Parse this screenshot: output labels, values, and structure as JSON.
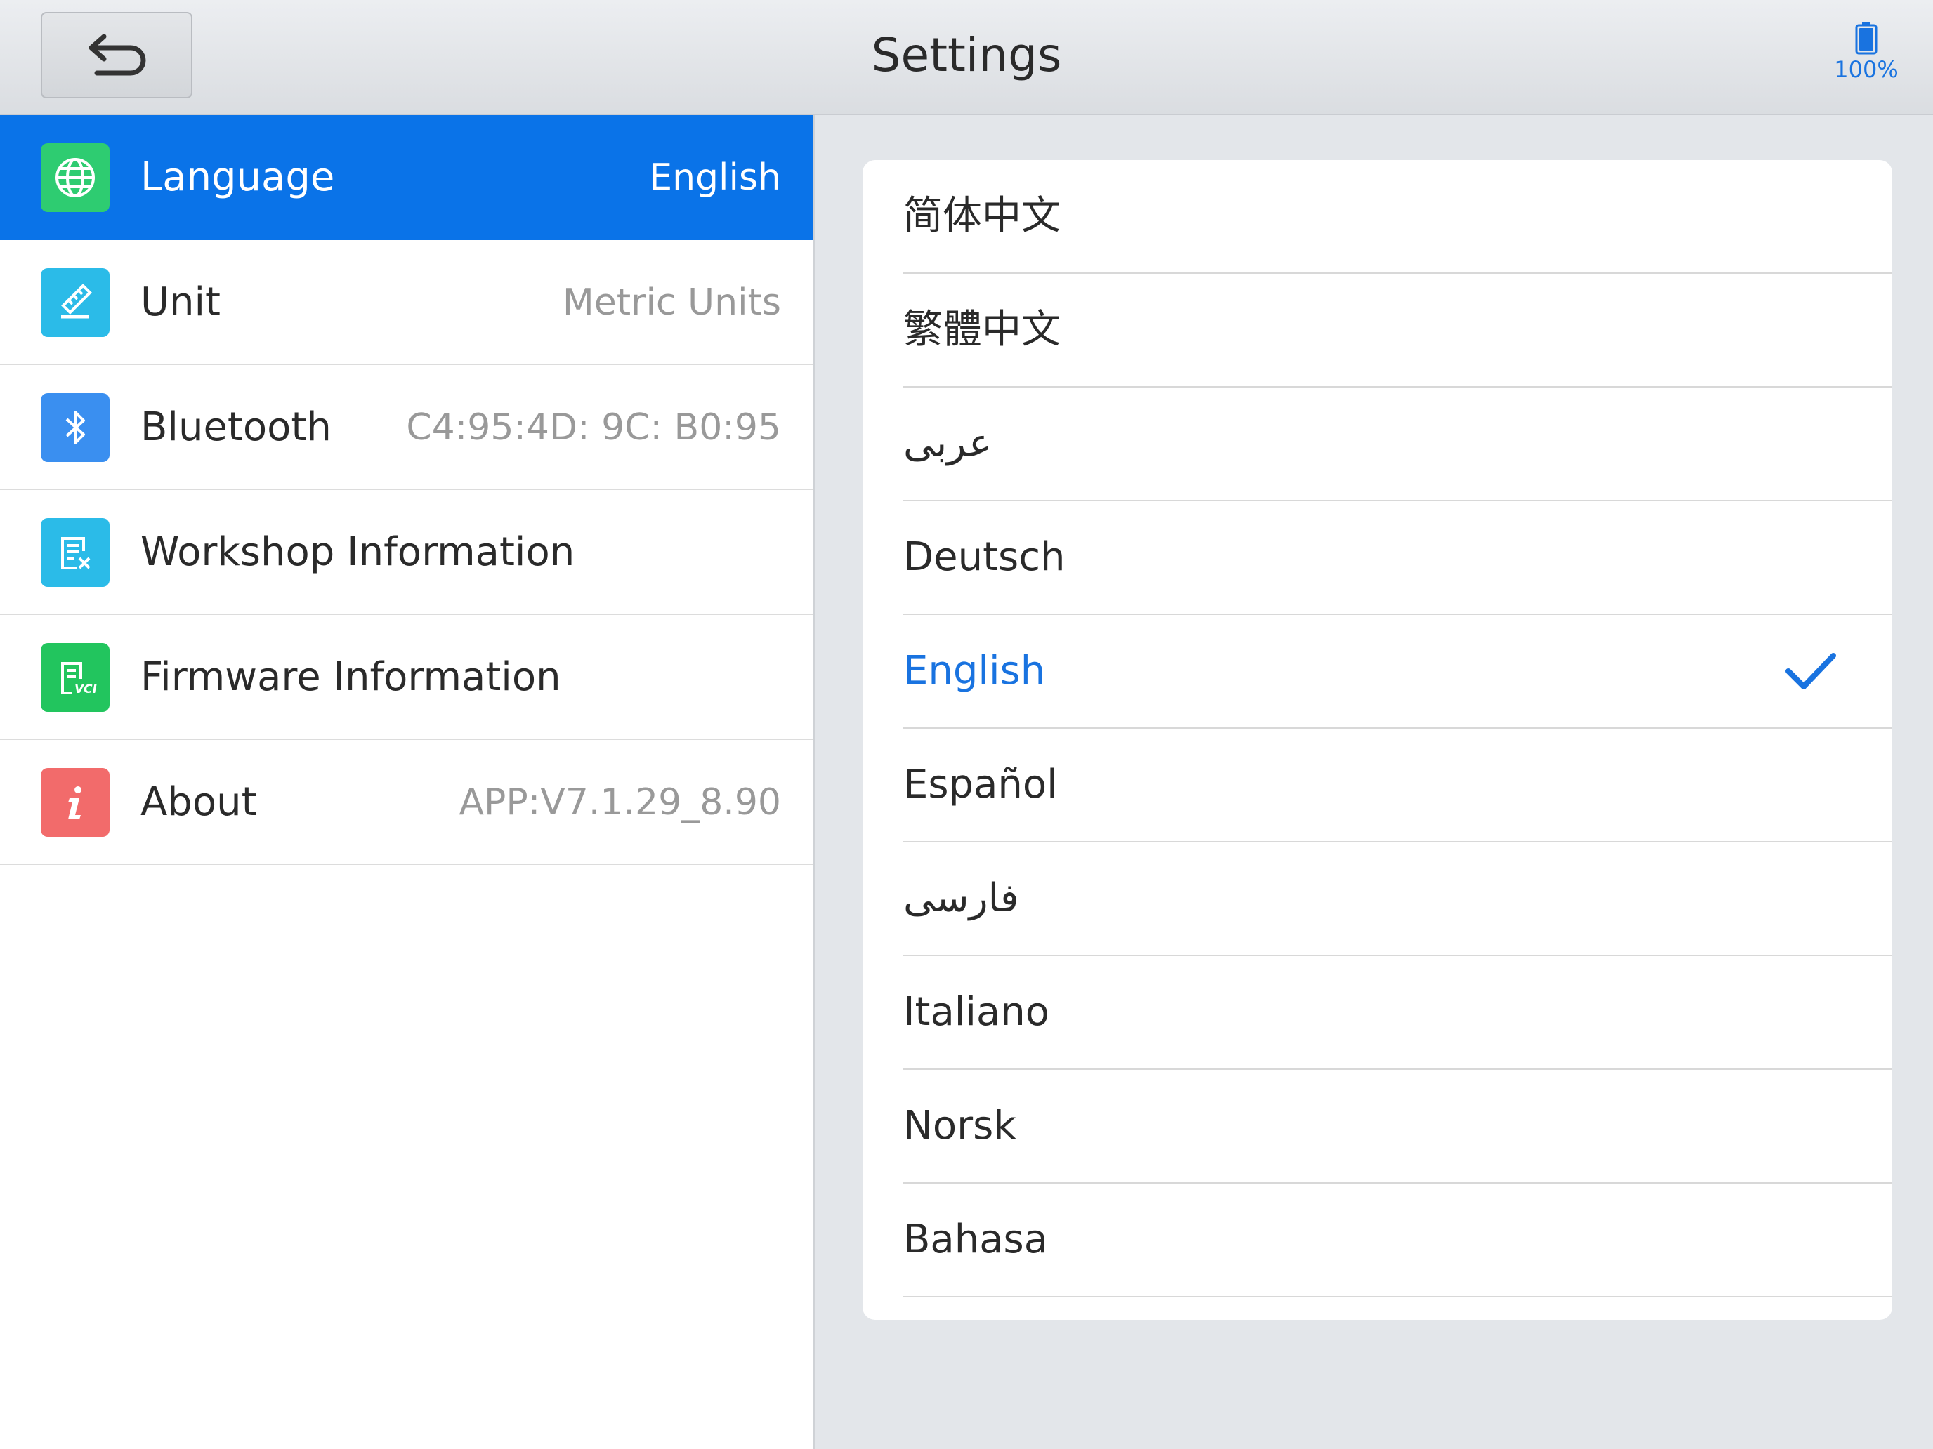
{
  "header": {
    "title": "Settings",
    "back_icon": "back-arrow-icon",
    "battery_label": "100%",
    "battery_icon": "battery-full-icon"
  },
  "menu": {
    "items": [
      {
        "key": "language",
        "label": "Language",
        "value": "English",
        "icon": "globe-icon",
        "icon_color": "#2ecc71",
        "active": true
      },
      {
        "key": "unit",
        "label": "Unit",
        "value": "Metric Units",
        "icon": "ruler-icon",
        "icon_color": "#2bbbe8",
        "active": false
      },
      {
        "key": "bluetooth",
        "label": "Bluetooth",
        "value": "C4:95:4D: 9C: B0:95",
        "icon": "bluetooth-icon",
        "icon_color": "#3a8ff0",
        "active": false
      },
      {
        "key": "workshop",
        "label": "Workshop Information",
        "value": "",
        "icon": "workshop-document-icon",
        "icon_color": "#2bbbe8",
        "active": false
      },
      {
        "key": "firmware",
        "label": "Firmware Information",
        "value": "",
        "icon": "vci-document-icon",
        "icon_color": "#22c55e",
        "active": false
      },
      {
        "key": "about",
        "label": "About",
        "value": "APP:V7.1.29_8.90",
        "icon": "info-icon",
        "icon_color": "#f26b6b",
        "active": false
      }
    ]
  },
  "languages": {
    "selected": "English",
    "items": [
      {
        "label": "简体中文"
      },
      {
        "label": "繁體中文"
      },
      {
        "label": "عربى"
      },
      {
        "label": "Deutsch"
      },
      {
        "label": "English",
        "selected": true
      },
      {
        "label": "Español"
      },
      {
        "label": "فارسى"
      },
      {
        "label": "Italiano"
      },
      {
        "label": "Norsk"
      },
      {
        "label": "Bahasa"
      }
    ],
    "check_icon": "checkmark-icon"
  },
  "colors": {
    "accent": "#0a73e8",
    "selected_text": "#1973e0",
    "secondary_text": "#999999"
  }
}
